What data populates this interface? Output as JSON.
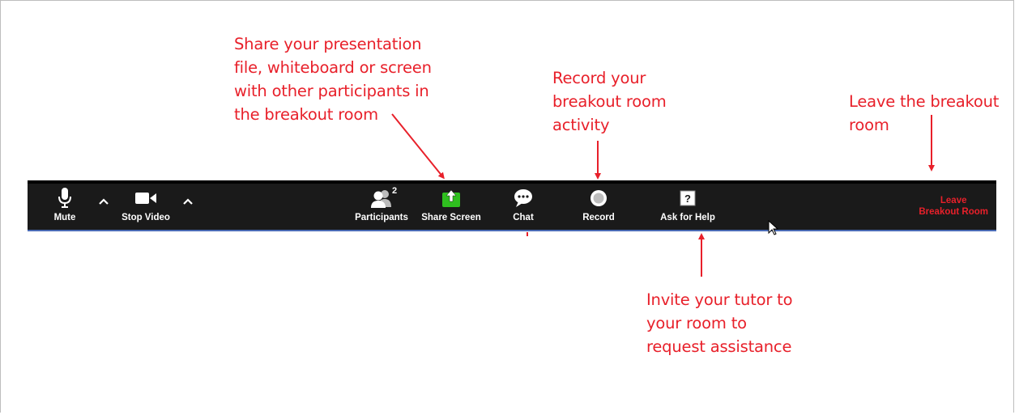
{
  "annotations": {
    "share": "Share your presentation\nfile, whiteboard or screen\nwith other participants in\nthe breakout room",
    "record": "Record your\nbreakout room\nactivity",
    "leave": "Leave the breakout\nroom",
    "help": "Invite your tutor to\nyour room to\nrequest assistance"
  },
  "toolbar": {
    "mute_label": "Mute",
    "stop_video_label": "Stop Video",
    "participants_label": "Participants",
    "participants_count": "2",
    "share_screen_label": "Share Screen",
    "chat_label": "Chat",
    "record_label": "Record",
    "ask_help_label": "Ask for Help",
    "leave_line1": "Leave",
    "leave_line2": "Breakout Room"
  },
  "icons": {
    "mute": "microphone-icon",
    "video": "video-camera-icon",
    "caret": "chevron-up-icon",
    "participants": "participants-icon",
    "share": "share-screen-icon",
    "chat": "chat-bubble-icon",
    "record": "record-icon",
    "help": "question-mark-icon"
  },
  "colors": {
    "annotation": "#e8202a",
    "toolbar_bg": "#1a1a1a",
    "share_green": "#2fbf1f",
    "leave_red": "#e8202a"
  }
}
